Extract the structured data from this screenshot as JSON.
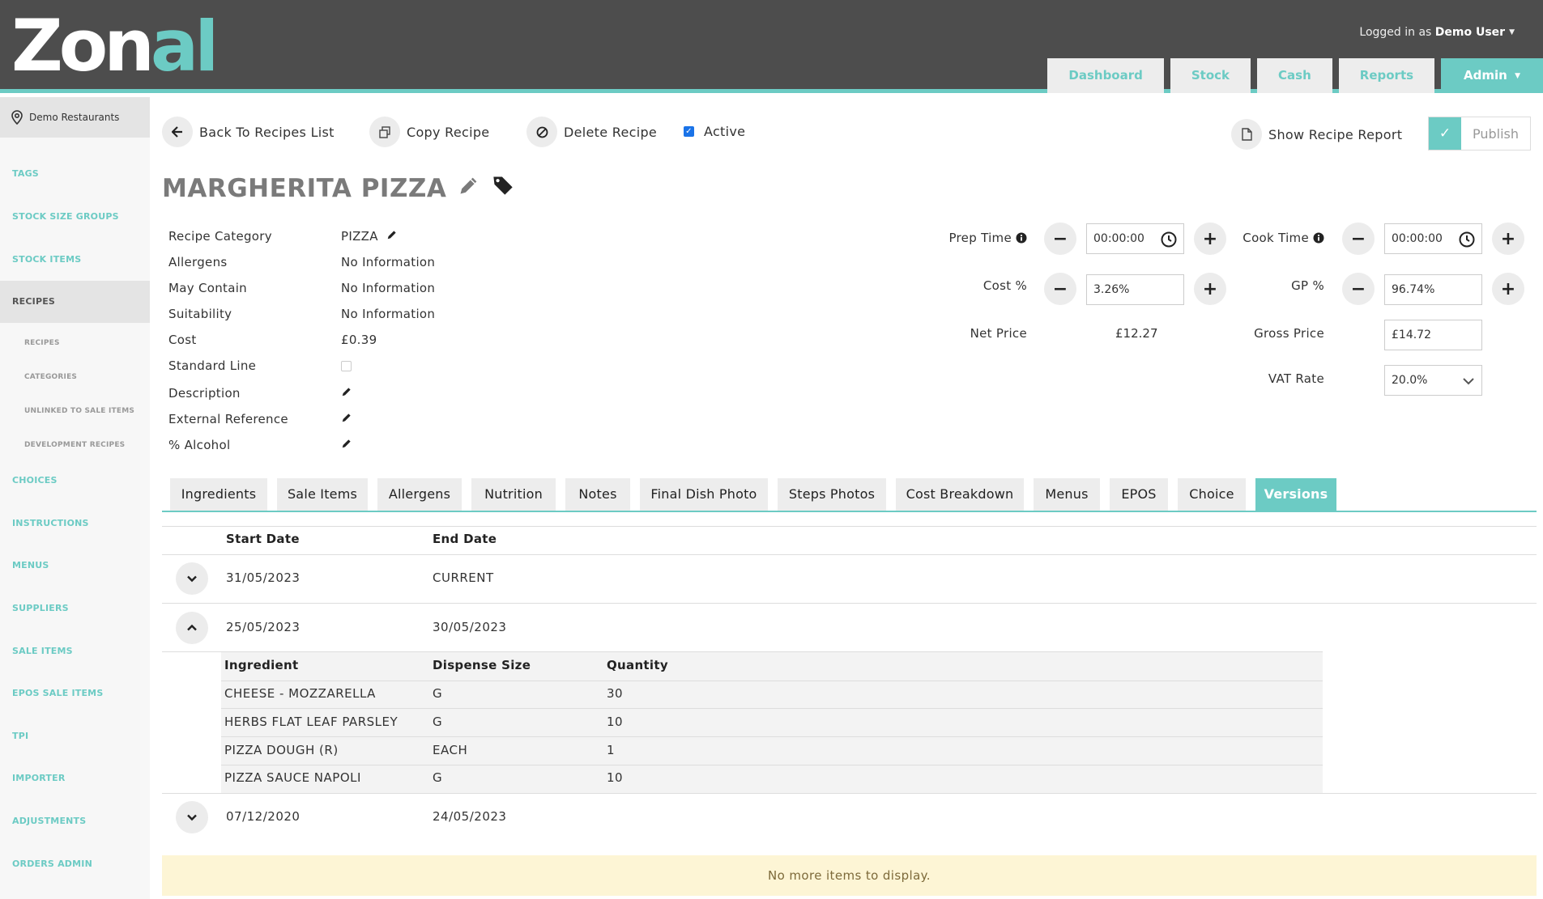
{
  "header": {
    "logo_text": "Zonal",
    "logged_in_prefix": "Logged in as",
    "user_name": "Demo User",
    "nav": [
      "Dashboard",
      "Stock",
      "Cash",
      "Reports",
      "Admin"
    ]
  },
  "sidebar": {
    "site": "Demo Restaurants",
    "items": [
      "TAGS",
      "STOCK SIZE GROUPS",
      "STOCK ITEMS",
      "RECIPES",
      "CHOICES",
      "INSTRUCTIONS",
      "MENUS",
      "SUPPLIERS",
      "SALE ITEMS",
      "EPOS SALE ITEMS",
      "TPI",
      "IMPORTER",
      "ADJUSTMENTS",
      "ORDERS ADMIN"
    ],
    "subitems": [
      "RECIPES",
      "CATEGORIES",
      "UNLINKED TO SALE ITEMS",
      "DEVELOPMENT RECIPES"
    ]
  },
  "actions": {
    "back": "Back To Recipes List",
    "copy": "Copy Recipe",
    "delete": "Delete Recipe",
    "active": "Active",
    "report": "Show Recipe Report",
    "publish": "Publish"
  },
  "recipe": {
    "title": "MARGHERITA PIZZA",
    "labels": {
      "category": "Recipe Category",
      "allergens": "Allergens",
      "may_contain": "May Contain",
      "suitability": "Suitability",
      "cost": "Cost",
      "standard_line": "Standard Line",
      "description": "Description",
      "external_reference": "External Reference",
      "alcohol": "% Alcohol"
    },
    "values": {
      "category": "PIZZA",
      "allergens": "No Information",
      "may_contain": "No Information",
      "suitability": "No Information",
      "cost": "£0.39"
    }
  },
  "pricing": {
    "prep_time_label": "Prep Time",
    "prep_time": "00:00:00",
    "cook_time_label": "Cook Time",
    "cook_time": "00:00:00",
    "cost_pct_label": "Cost %",
    "cost_pct": "3.26%",
    "gp_pct_label": "GP %",
    "gp_pct": "96.74%",
    "net_price_label": "Net Price",
    "net_price": "£12.27",
    "gross_price_label": "Gross Price",
    "gross_price": "£14.72",
    "vat_label": "VAT Rate",
    "vat": "20.0%"
  },
  "tabs": [
    "Ingredients",
    "Sale Items",
    "Allergens",
    "Nutrition",
    "Notes",
    "Final Dish Photo",
    "Steps Photos",
    "Cost Breakdown",
    "Menus",
    "EPOS",
    "Choice",
    "Versions"
  ],
  "versions": {
    "col_start": "Start Date",
    "col_end": "End Date",
    "rows": [
      {
        "start": "31/05/2023",
        "end": "CURRENT"
      },
      {
        "start": "25/05/2023",
        "end": "30/05/2023"
      },
      {
        "start": "07/12/2020",
        "end": "24/05/2023"
      }
    ],
    "detail": {
      "col_ingredient": "Ingredient",
      "col_dispense": "Dispense Size",
      "col_quantity": "Quantity",
      "rows": [
        {
          "ingredient": "CHEESE - MOZZARELLA",
          "dispense": "G",
          "quantity": "30"
        },
        {
          "ingredient": "HERBS FLAT LEAF PARSLEY",
          "dispense": "G",
          "quantity": "10"
        },
        {
          "ingredient": "PIZZA DOUGH (R)",
          "dispense": "EACH",
          "quantity": "1"
        },
        {
          "ingredient": "PIZZA SAUCE NAPOLI",
          "dispense": "G",
          "quantity": "10"
        }
      ]
    },
    "footer": "No more items to display."
  }
}
